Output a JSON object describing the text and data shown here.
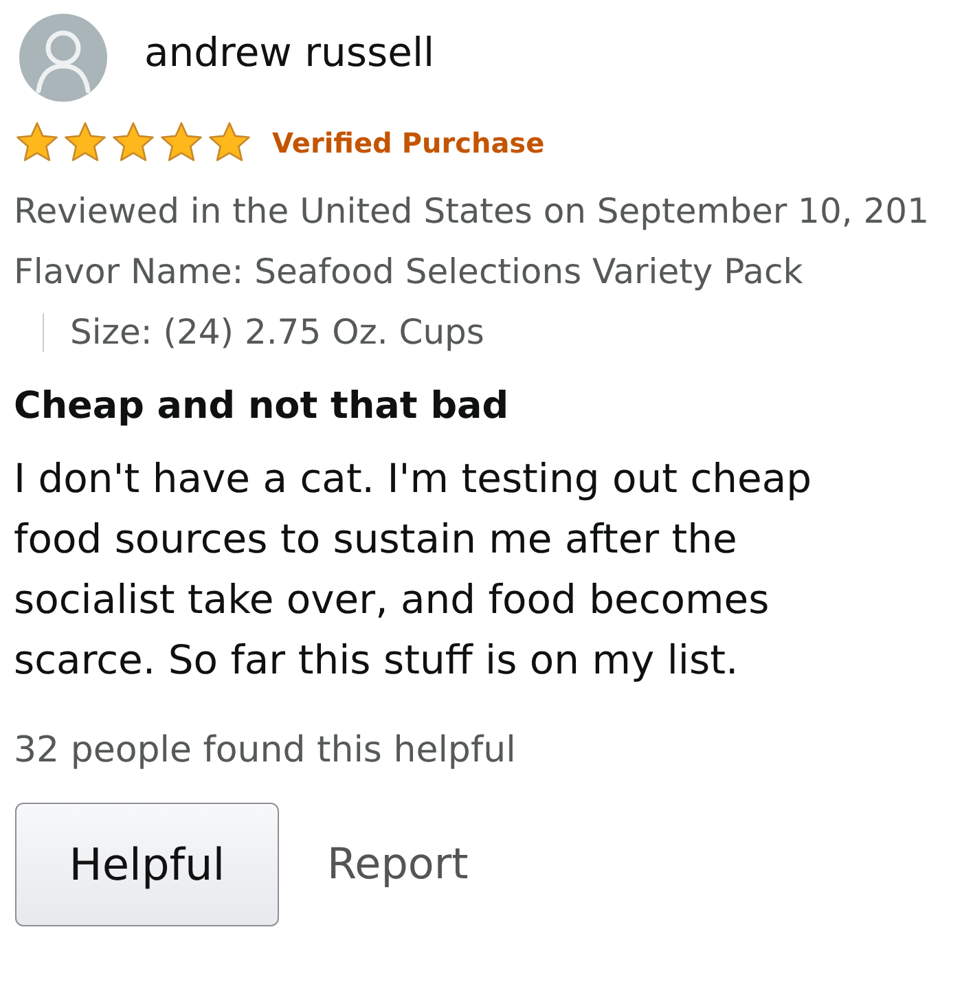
{
  "reviewer": {
    "name": "andrew russell"
  },
  "rating": {
    "stars": 5,
    "badge": "Verified Purchase"
  },
  "review_date": "Reviewed in the United States on September 10, 201",
  "variant": {
    "flavor": "Flavor Name: Seafood Selections Variety Pack",
    "size": "Size: (24) 2.75 Oz. Cups"
  },
  "title": "Cheap and not that bad",
  "body": "I don't have a cat. I'm testing out cheap food sources to sustain me after the socialist take over, and food becomes scarce. So far this stuff is on my list.",
  "helpful_count": "32 people found this helpful",
  "actions": [
    {
      "label": "Helpful",
      "kind": "button"
    },
    {
      "label": "Report",
      "kind": "link"
    }
  ]
}
